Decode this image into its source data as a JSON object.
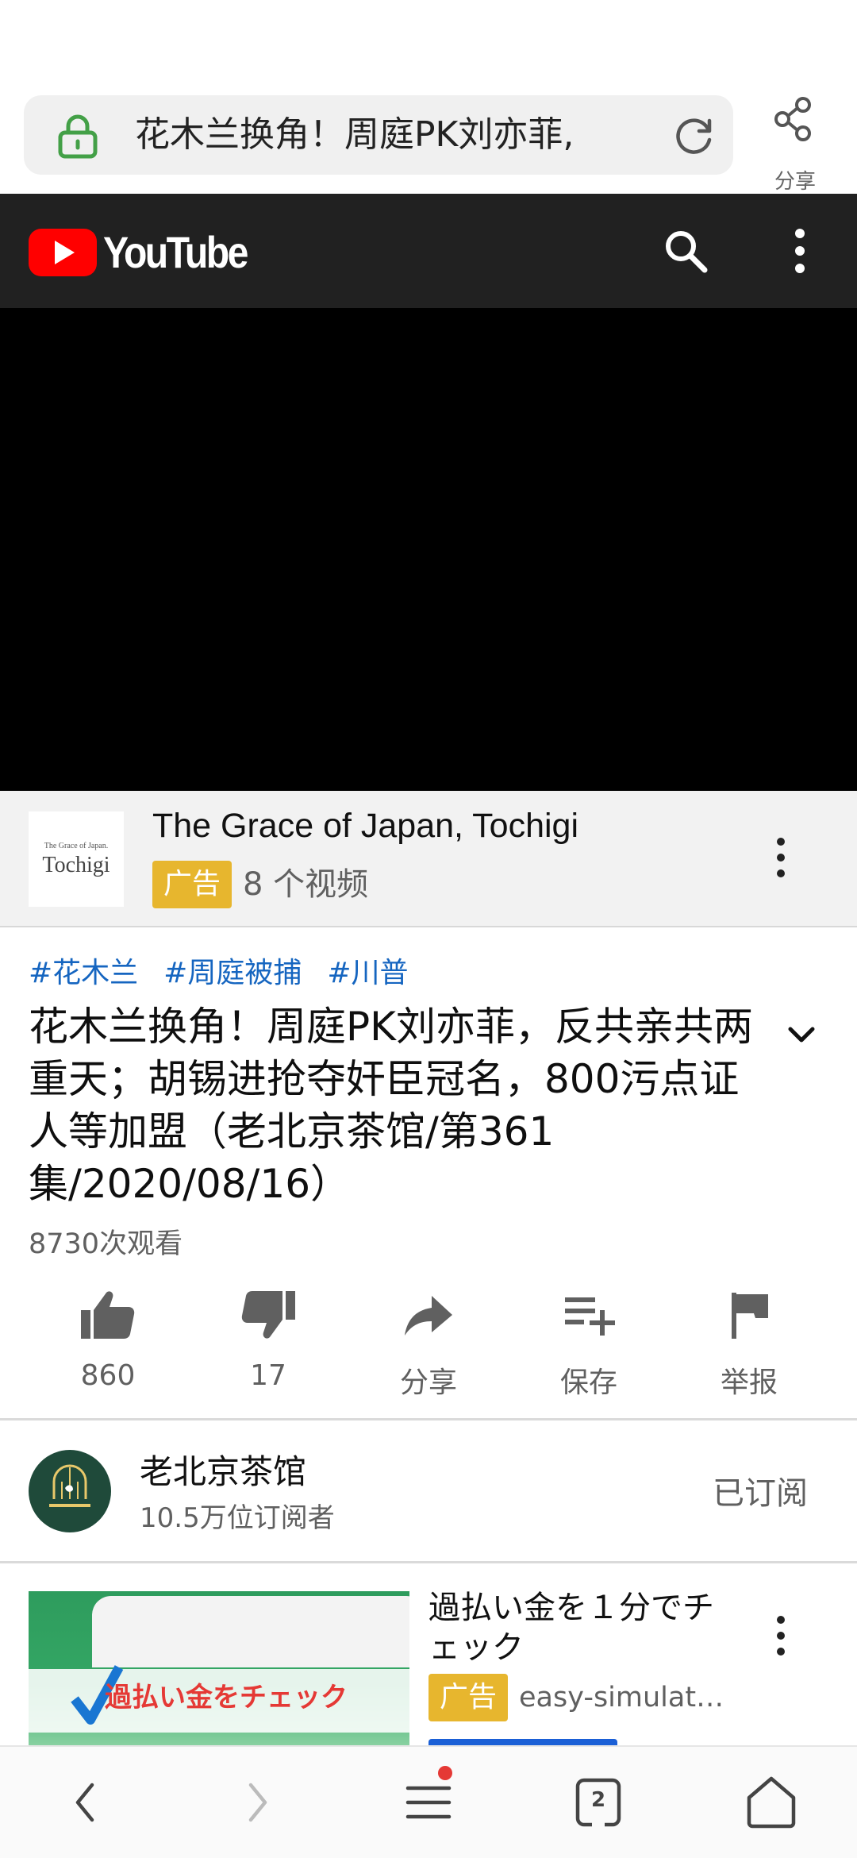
{
  "browser": {
    "url_text": "花木兰换角！周庭PK刘亦菲,",
    "share_label": "分享"
  },
  "youtube": {
    "logo_text": "YouTube"
  },
  "ad_banner": {
    "thumb_small": "The Grace of Japan.",
    "thumb_big": "Tochigi",
    "title": "The Grace of Japan, Tochigi",
    "badge": "广告",
    "video_count": "8 个视频"
  },
  "video": {
    "tags": [
      "#花木兰",
      "#周庭被捕",
      "#川普"
    ],
    "title": "花木兰换角！周庭PK刘亦菲，反共亲共两重天；胡锡进抢夺奸臣冠名，800污点证人等加盟（老北京茶馆/第361集/2020/08/16）",
    "views": "8730次观看"
  },
  "actions": [
    {
      "icon": "thumbs-up-icon",
      "label": "860"
    },
    {
      "icon": "thumbs-down-icon",
      "label": "17"
    },
    {
      "icon": "share-arrow-icon",
      "label": "分享"
    },
    {
      "icon": "playlist-add-icon",
      "label": "保存"
    },
    {
      "icon": "flag-icon",
      "label": "举报"
    }
  ],
  "channel": {
    "name": "老北京茶馆",
    "subscribers": "10.5万位订阅者",
    "subscribe_state": "已订阅"
  },
  "recommendation": {
    "thumb_text": "過払い金をチェック",
    "title": "過払い金を１分でチェック",
    "badge": "广告",
    "domain": "easy-simulator...."
  },
  "bottom_nav": {
    "tab_count": "2"
  },
  "colors": {
    "youtube_red": "#ff0000",
    "header_bg": "#212121",
    "ad_badge": "#e7b62e",
    "tag_blue": "#1565c0",
    "lock_green": "#43a047"
  }
}
